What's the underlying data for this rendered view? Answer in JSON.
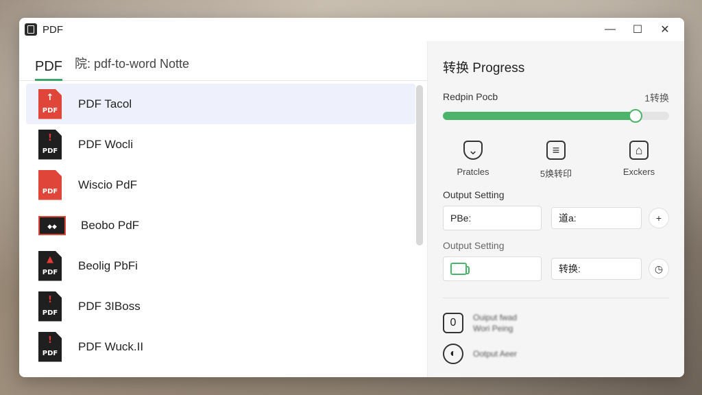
{
  "window": {
    "title": "PDF",
    "controls": {
      "minimize": "—",
      "maximize": "☐",
      "close": "✕"
    }
  },
  "left": {
    "tab": "PDF",
    "subtitle": "院: pdf-to-word Notte",
    "items": [
      {
        "label": "PDF Tacol",
        "icon": "pdf-file-icon",
        "tag": "PDF",
        "mark": "↑",
        "style": "red"
      },
      {
        "label": "PDF Wocli",
        "icon": "pdf-file-icon",
        "tag": "PDF",
        "mark": "!",
        "style": "dark"
      },
      {
        "label": "Wiscio PdF",
        "icon": "pdf-file-icon",
        "tag": "PDF",
        "mark": "",
        "style": "red"
      },
      {
        "label": "Beobo PdF",
        "icon": "pdf-file-icon",
        "tag": "◆◆",
        "mark": "",
        "style": "wide"
      },
      {
        "label": "Beolig PbFi",
        "icon": "pdf-file-icon",
        "tag": "PDF",
        "mark": "▲",
        "style": "dark"
      },
      {
        "label": "PDF 3IBoss",
        "icon": "pdf-file-icon",
        "tag": "PDF",
        "mark": "!",
        "style": "dark"
      },
      {
        "label": "PDF Wuck.II",
        "icon": "pdf-file-icon",
        "tag": "PDF",
        "mark": "!",
        "style": "dark"
      }
    ]
  },
  "right": {
    "title": "转换 Progress",
    "progress_label": "Redpin Pocb",
    "progress_count": "1转换",
    "progress_value": 0.85,
    "accent": "#4cb36a",
    "actions": [
      {
        "label": "Pratcles",
        "icon": "chevron-shield-icon",
        "glyph": "⌄"
      },
      {
        "label": "5焕转印",
        "icon": "document-icon",
        "glyph": "≡"
      },
      {
        "label": "Exckers",
        "icon": "home-box-icon",
        "glyph": "⌂"
      }
    ],
    "output_setting_1": "Output Setting",
    "field_a_value": "PBe:",
    "field_b_value": "道a:",
    "add_glyph": "+",
    "output_setting_2": "Output Setting",
    "field_d_value": "转换:",
    "timer_glyph": "◷",
    "bottom": [
      {
        "glyph": "0",
        "line1": "Ouiput fwad",
        "line2": "Wori Peing"
      },
      {
        "glyph": "◐",
        "line1": "Ootput Aeer",
        "line2": ""
      }
    ]
  }
}
